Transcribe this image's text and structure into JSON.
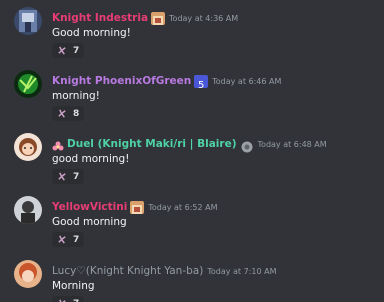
{
  "messages": [
    {
      "username": "Knight Indestria",
      "timestamp": "Today at 4:36 AM",
      "text": "Good morning!",
      "reaction_count": "7",
      "badge_icon": "knight-badge-icon",
      "name_color": "#e83c75"
    },
    {
      "username": "Knight PhoenixOfGreen",
      "timestamp": "Today at 6:46 AM",
      "text": "morning!",
      "reaction_count": "8",
      "badge_icon": "role-badge-icon",
      "name_color": "#b87ae0"
    },
    {
      "username": "Duel (Knight Maki/ri | Blaire)",
      "timestamp": "Today at 6:48 AM",
      "text": "good morning!",
      "reaction_count": "7",
      "badge_icon": "server-badge-icon",
      "prefix_icon": "flower-icon",
      "name_color": "#4fd1a6"
    },
    {
      "username": "YellowVictini",
      "timestamp": "Today at 6:52 AM",
      "text": "Good morning",
      "reaction_count": "7",
      "badge_icon": "knight-badge-icon",
      "name_color": "#e83c75"
    },
    {
      "username": "Lucy♡(Knight Knight Yan-ba)",
      "timestamp": "Today at 7:10 AM",
      "text": "Morning",
      "reaction_count": "7",
      "name_color": "#949ba4"
    }
  ],
  "reaction_icon": "cherry-blossom-icon",
  "colors": {
    "background": "#313338",
    "reaction_bg": "#2b2d31",
    "timestamp": "#949ba4"
  }
}
